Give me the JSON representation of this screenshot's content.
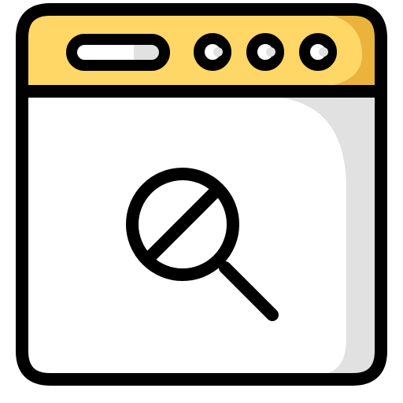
{
  "icon": {
    "name": "browser-window-search-blocked-icon",
    "colors": {
      "outline": "#000000",
      "header": "#FFD766",
      "header_shade": "#EAB33C",
      "body": "#FFFFFF",
      "body_shade": "#E1E1E1",
      "url_bar_shade": "#E1E1E1"
    },
    "parts": {
      "window": "browser-window-icon",
      "address_bar": "address-bar-icon",
      "controls": [
        "window-control-dot-icon",
        "window-control-dot-icon",
        "window-control-dot-icon"
      ],
      "search": "magnifier-slash-icon"
    }
  }
}
